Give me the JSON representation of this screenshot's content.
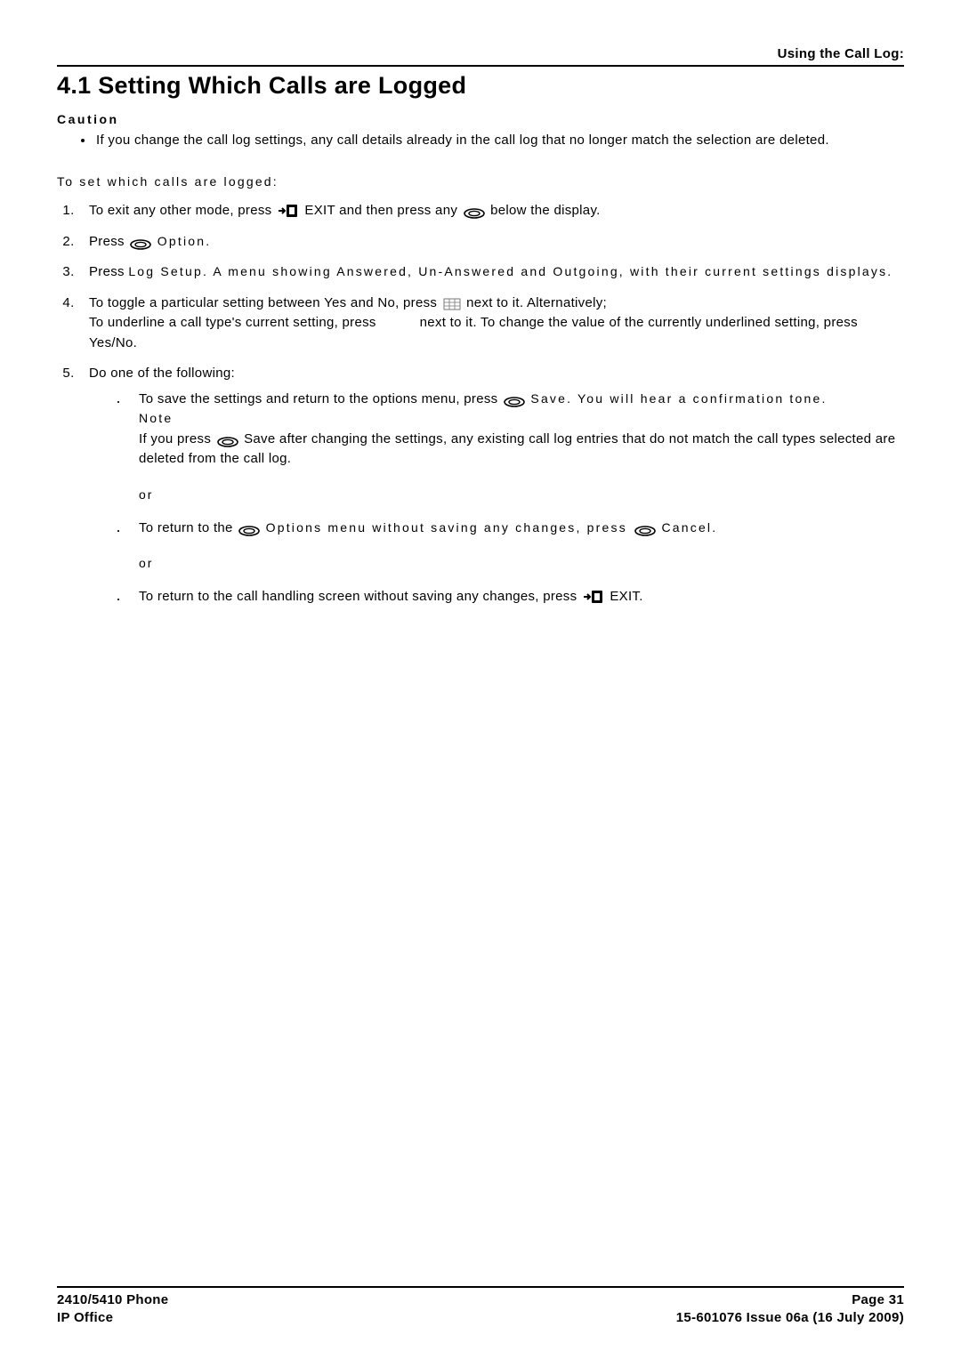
{
  "header": {
    "section_label": "Using the Call Log:"
  },
  "title": "4.1 Setting Which Calls are Logged",
  "caution_label": "Caution",
  "caution_text": "If you change the call log settings, any call details already in the call log that no longer match the selection are deleted.",
  "intro": "To set which calls are logged:",
  "steps": {
    "s1_a": "To exit any other mode, press ",
    "s1_b": " EXIT and then press any ",
    "s1_c": " below the display.",
    "s2_a": "Press ",
    "s2_b": " Option.",
    "s3_a": "Press ",
    "s3_b": " Log Setup. A menu showing Answered, Un-Answered and Outgoing, with their current settings displays.",
    "s4_a": "To toggle a particular setting between Yes and No, press ",
    "s4_b": " next to it. Alternatively;",
    "s4_c": "To underline a call type's current setting, press ",
    "s4_d": " next to it. To change the value of the currently underlined setting, press Yes/No.",
    "s5": "Do one of the following:"
  },
  "sub": {
    "a1": "To save the settings and return to the options menu, press ",
    "a2": " Save. You will hear a confirmation tone.",
    "note_label": "Note",
    "a3": "If you press ",
    "a4": " Save after changing the settings, any existing call log entries that do not match the call types selected are deleted from the call log.",
    "or": "or",
    "b1": "To return to the ",
    "b2": " Options menu without saving any changes, press ",
    "b3": " Cancel.",
    "c1": "To return to the call handling screen without saving any changes, press ",
    "c2": " EXIT."
  },
  "footer": {
    "left1": "2410/5410 Phone",
    "left2": "IP Office",
    "right1": "Page 31",
    "right2": "15-601076 Issue 06a (16 July 2009)"
  }
}
